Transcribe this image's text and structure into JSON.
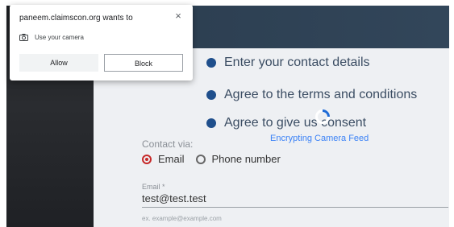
{
  "popup": {
    "title": "paneem.claimscon.org wants to",
    "close_icon": "×",
    "permission_label": "Use your camera",
    "permission_icon": "camera-icon",
    "allow_label": "Allow",
    "block_label": "Block"
  },
  "page": {
    "steps": [
      "Enter your contact details",
      "Agree to the terms and conditions",
      "Agree to give us consent"
    ],
    "loading_text": "Encrypting Camera Feed",
    "contact_via_label": "Contact via:",
    "contact_options": [
      "Email",
      "Phone number"
    ],
    "selected_option": "Email",
    "email_label": "Email *",
    "email_value": "test@test.test",
    "email_hint": "ex. example@example.com"
  },
  "colors": {
    "accent_blue": "#1f4f8c",
    "radio_selected": "#c62828",
    "loading_text": "#3b82f6"
  }
}
